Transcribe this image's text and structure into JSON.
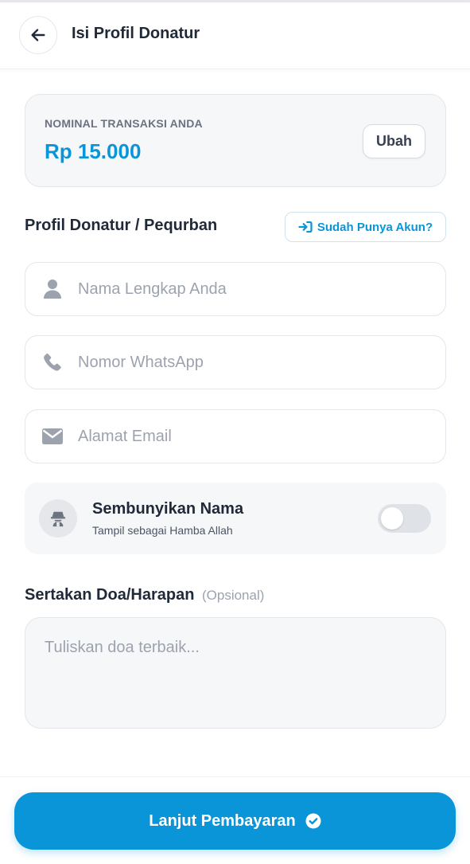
{
  "header": {
    "title": "Isi Profil Donatur",
    "back_icon": "arrow-left-icon"
  },
  "nominal": {
    "label": "NOMINAL TRANSAKSI ANDA",
    "value": "Rp 15.000",
    "change_label": "Ubah"
  },
  "profile": {
    "title": "Profil Donatur / Pequrban",
    "account_button": "Sudah Punya Akun?",
    "account_icon": "sign-in-icon",
    "fields": [
      {
        "icon": "user-icon",
        "placeholder": "Nama Lengkap Anda",
        "value": ""
      },
      {
        "icon": "phone-icon",
        "placeholder": "Nomor WhatsApp",
        "value": ""
      },
      {
        "icon": "envelope-icon",
        "placeholder": "Alamat Email",
        "value": ""
      }
    ]
  },
  "anonymous": {
    "title": "Sembunyikan Nama",
    "subtitle": "Tampil sebagai Hamba Allah",
    "icon": "incognito-icon",
    "enabled": false
  },
  "doa": {
    "title": "Sertakan Doa/Harapan",
    "optional_label": "(Opsional)",
    "placeholder": "Tuliskan doa terbaik...",
    "value": ""
  },
  "footer": {
    "submit_label": "Lanjut Pembayaran",
    "submit_icon": "check-circle-icon"
  },
  "colors": {
    "accent": "#0b95d9",
    "text": "#1f2937",
    "muted": "#9ca3af",
    "card_bg": "#f6f7f9"
  }
}
